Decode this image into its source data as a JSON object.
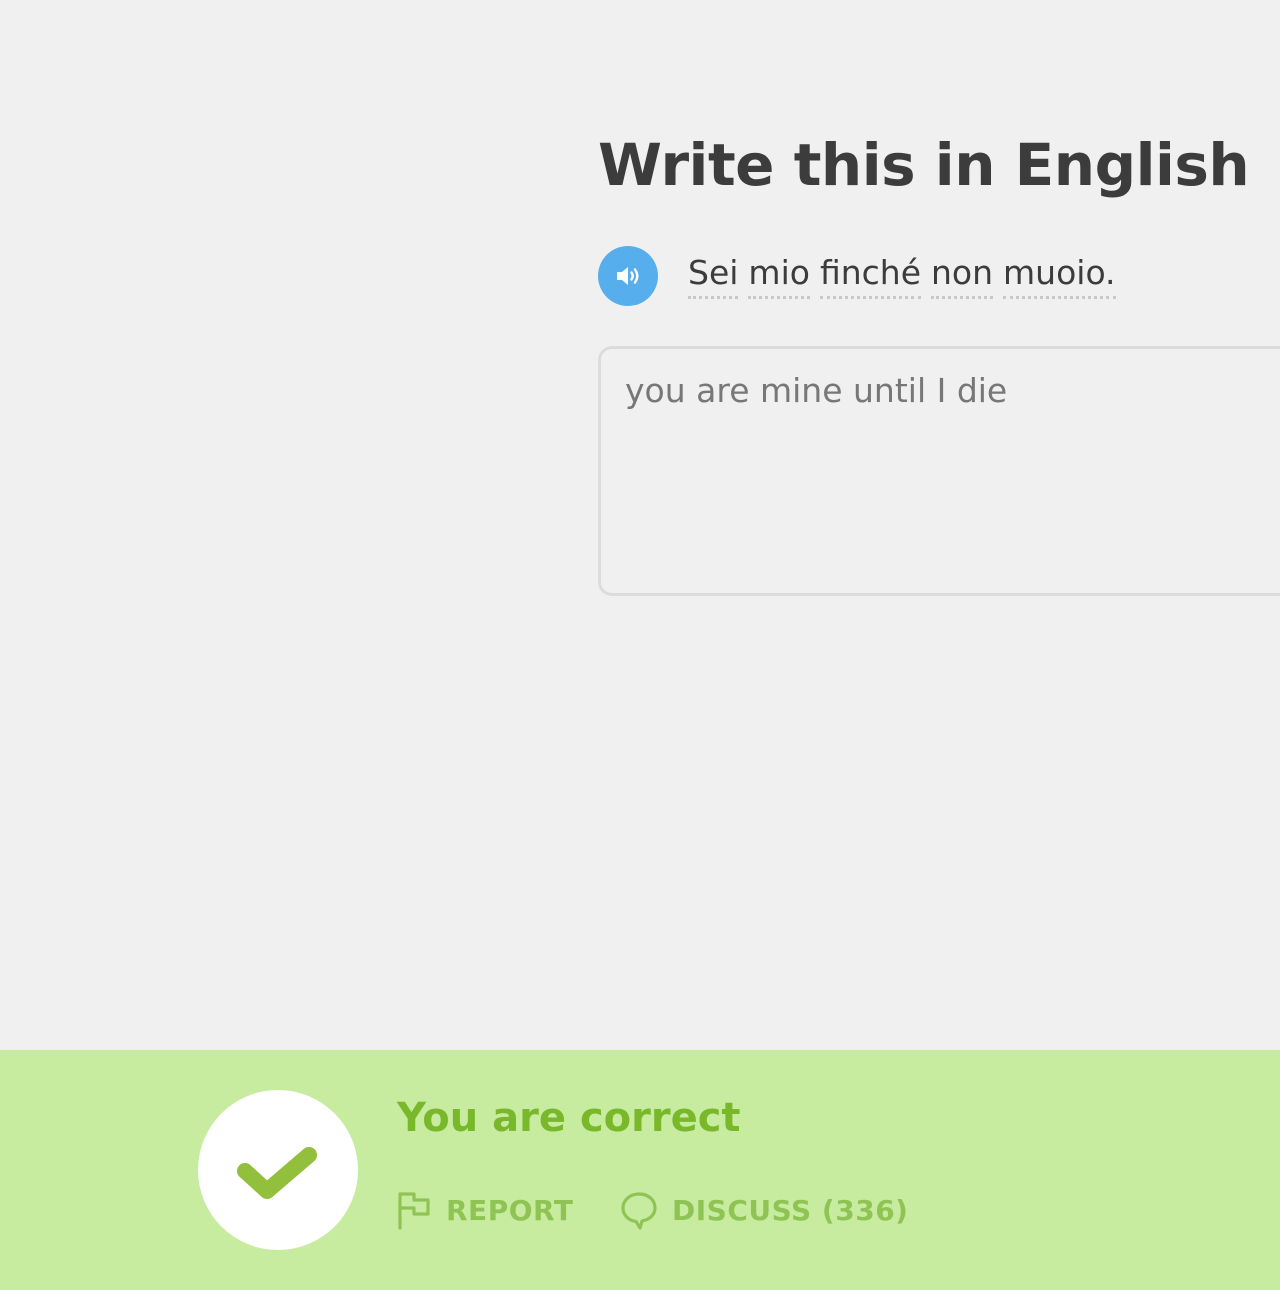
{
  "challenge": {
    "title": "Write this in English",
    "sentence_tokens": [
      "Sei",
      "mio",
      "finché",
      "non",
      "muoio."
    ],
    "answer": "you are mine until I die"
  },
  "feedback": {
    "message": "You are correct",
    "report_label": "REPORT",
    "discuss_label": "DISCUSS (336)"
  },
  "colors": {
    "background": "#f0f0f0",
    "speaker_blue": "#57aeec",
    "correct_banner": "#c8ec9f",
    "correct_text": "#78b82a"
  },
  "icons": {
    "speaker": "speaker-icon",
    "check": "checkmark-icon",
    "report": "flag-icon",
    "discuss": "speech-bubble-icon"
  }
}
